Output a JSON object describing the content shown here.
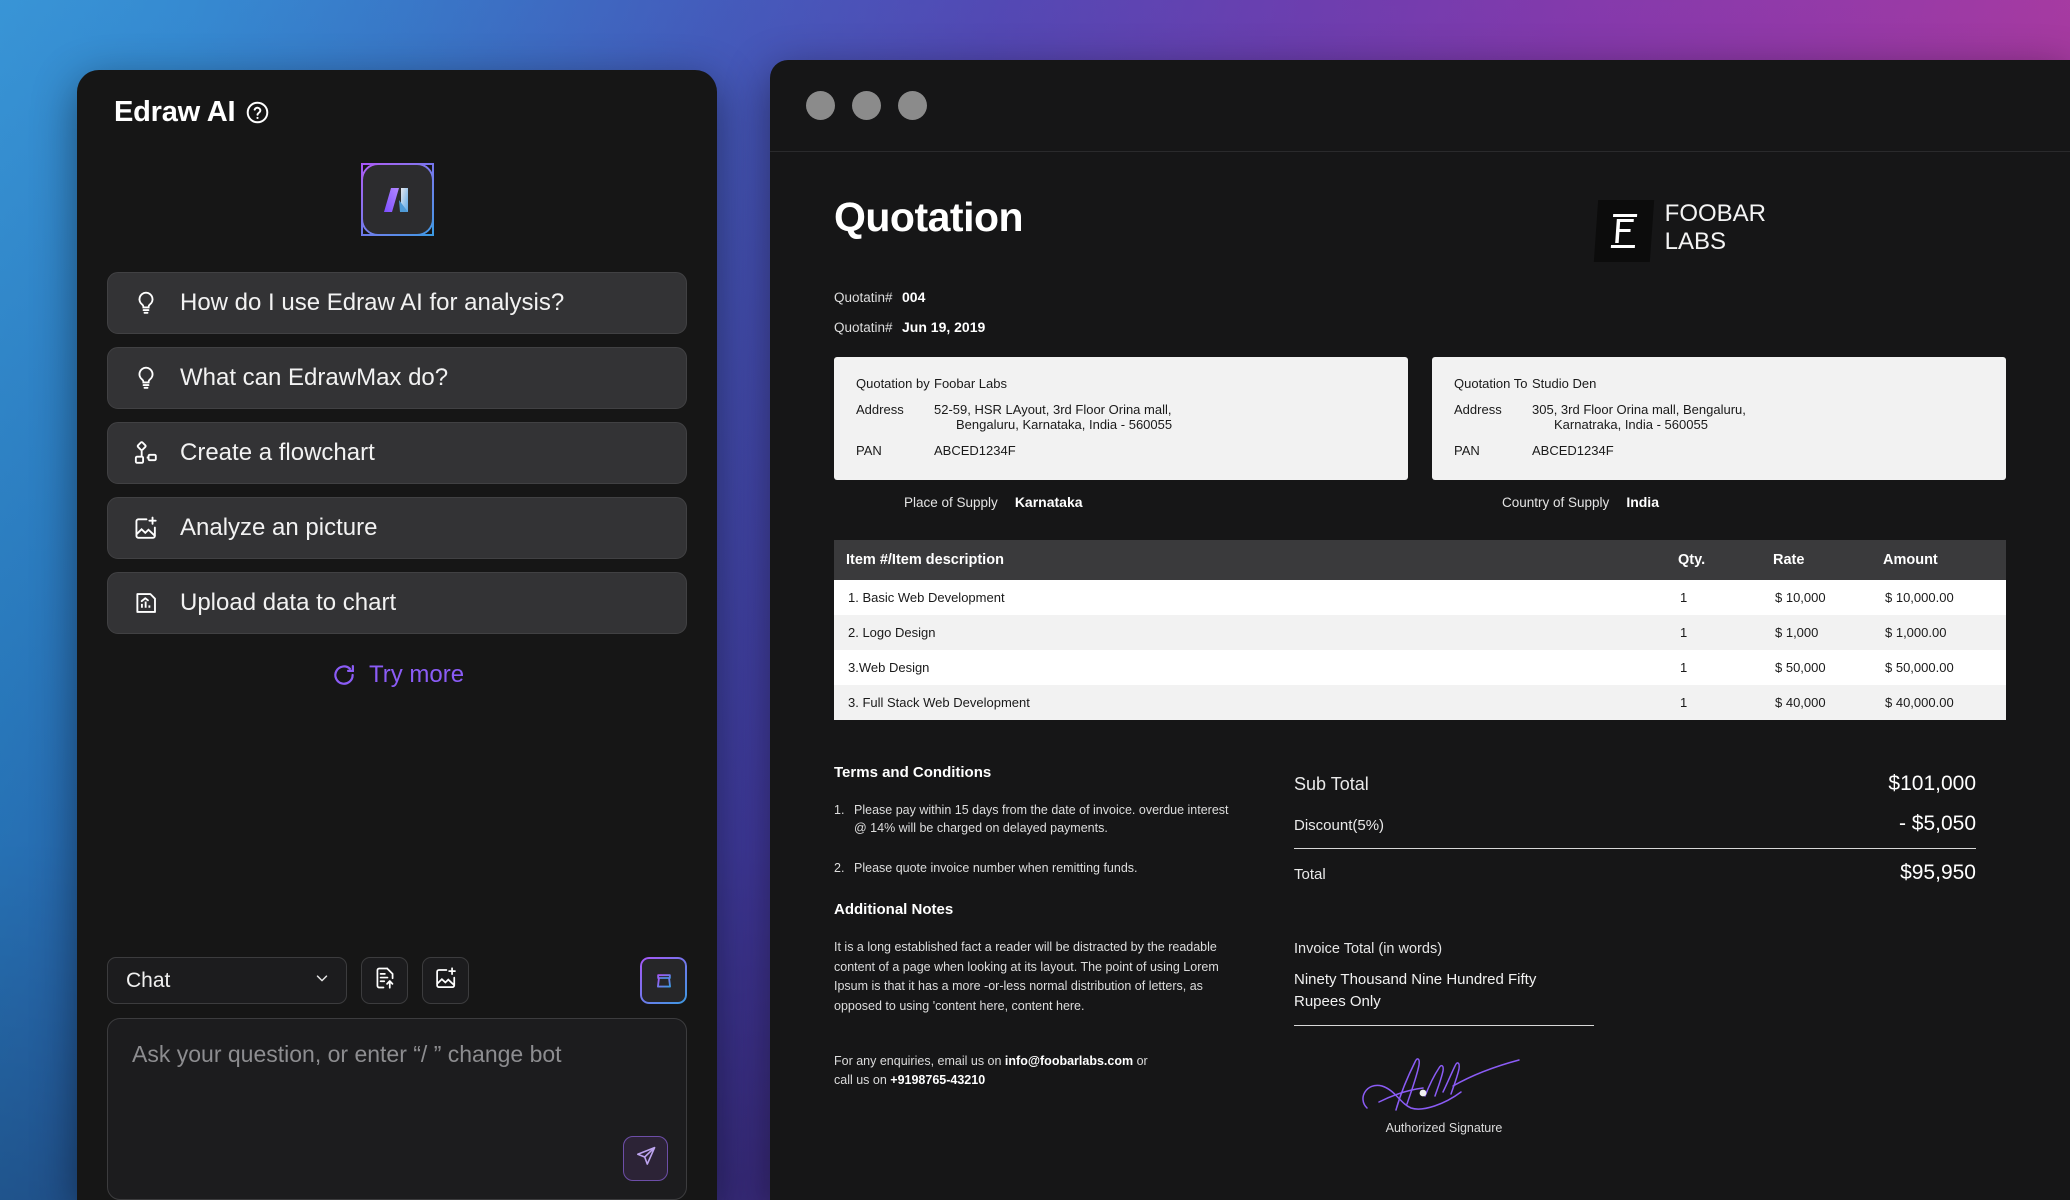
{
  "chat": {
    "title": "Edraw AI",
    "help_icon": "question-circle-icon",
    "logo_icon": "edraw-ai-logo",
    "suggestions": [
      {
        "label": "How do I use Edraw AI for analysis?",
        "icon": "lightbulb-icon"
      },
      {
        "label": "What can EdrawMax do?",
        "icon": "lightbulb-icon"
      },
      {
        "label": "Create a flowchart",
        "icon": "flowchart-icon"
      },
      {
        "label": "Analyze an picture",
        "icon": "image-plus-icon"
      },
      {
        "label": "Upload data to chart",
        "icon": "chart-file-icon"
      }
    ],
    "try_more": {
      "label": "Try more",
      "icon": "refresh-icon"
    },
    "composer": {
      "model": "Chat",
      "chevron_icon": "chevron-down-icon",
      "upload_doc_icon": "document-upload-icon",
      "upload_image_icon": "image-plus-icon",
      "clean_icon": "broom-icon",
      "placeholder": "Ask your question, or enter  “/ ” change bot",
      "send_icon": "send-icon"
    },
    "accent": "#8b5cf6"
  },
  "doc_window": {
    "traffic_lights": [
      "dot-1",
      "dot-2",
      "dot-3"
    ]
  },
  "document": {
    "title": "Quotation",
    "brand": {
      "mark": "F",
      "name_line1": "FOOBAR",
      "name_line2": "LABS"
    },
    "meta": [
      {
        "key": "Quotatin#",
        "value": "004"
      },
      {
        "key": "Quotatin#",
        "value": "Jun 19, 2019"
      }
    ],
    "party_from": {
      "role_key": "Quotation by",
      "role_value": "Foobar Labs",
      "address_key": "Address",
      "address_line1": "52-59, HSR LAyout, 3rd Floor Orina mall,",
      "address_line2": "Bengaluru, Karnataka, India - 560055",
      "pan_key": "PAN",
      "pan_value": "ABCED1234F"
    },
    "party_to": {
      "role_key": "Quotation To",
      "role_value": "Studio Den",
      "address_key": "Address",
      "address_line1": "305, 3rd Floor Orina mall, Bengaluru,",
      "address_line2": "Karnatraka, India - 560055",
      "pan_key": "PAN",
      "pan_value": "ABCED1234F"
    },
    "supply": [
      {
        "key": "Place of Supply",
        "value": "Karnataka"
      },
      {
        "key": "Country of Supply",
        "value": "India"
      }
    ],
    "items_table": {
      "headers": [
        "Item #/Item description",
        "Qty.",
        "Rate",
        "Amount"
      ],
      "rows": [
        [
          "1. Basic Web Development",
          "1",
          "$ 10,000",
          "$ 10,000.00"
        ],
        [
          "2. Logo Design",
          "1",
          "$ 1,000",
          "$ 1,000.00"
        ],
        [
          "3.Web Design",
          "1",
          "$ 50,000",
          "$ 50,000.00"
        ],
        [
          "3. Full Stack Web Development",
          "1",
          "$ 40,000",
          "$ 40,000.00"
        ]
      ]
    },
    "terms": {
      "heading": "Terms and Conditions",
      "items": [
        {
          "n": "1.",
          "text": "Please pay within 15 days from the date of invoice. overdue interest @ 14% will be charged on delayed payments."
        },
        {
          "n": "2.",
          "text": "Please quote invoice number when remitting funds."
        }
      ]
    },
    "notes": {
      "heading": "Additional Notes",
      "text": "It is a long established fact a reader will be distracted by the readable content of a page when looking at its layout. The point of using Lorem Ipsum is that it has a more -or-less normal distribution of letters, as opposed to using 'content here, content here."
    },
    "enquiry": {
      "line1_pre": "For any enquiries, email us on ",
      "email": "info@foobarlabs.com",
      "line1_post": " or",
      "line2_pre": "call us on ",
      "phone": "+9198765-43210"
    },
    "totals": [
      {
        "key": "Sub Total",
        "value": "$101,000"
      },
      {
        "key": "Discount(5%)",
        "value": "- $5,050"
      },
      {
        "key": "Total",
        "value": "$95,950"
      }
    ],
    "in_words": {
      "heading": "Invoice Total (in words)",
      "line1": "Ninety Thousand Nine Hundred Fifty",
      "line2": "Rupees Only"
    },
    "signature_caption": "Authorized Signature"
  }
}
